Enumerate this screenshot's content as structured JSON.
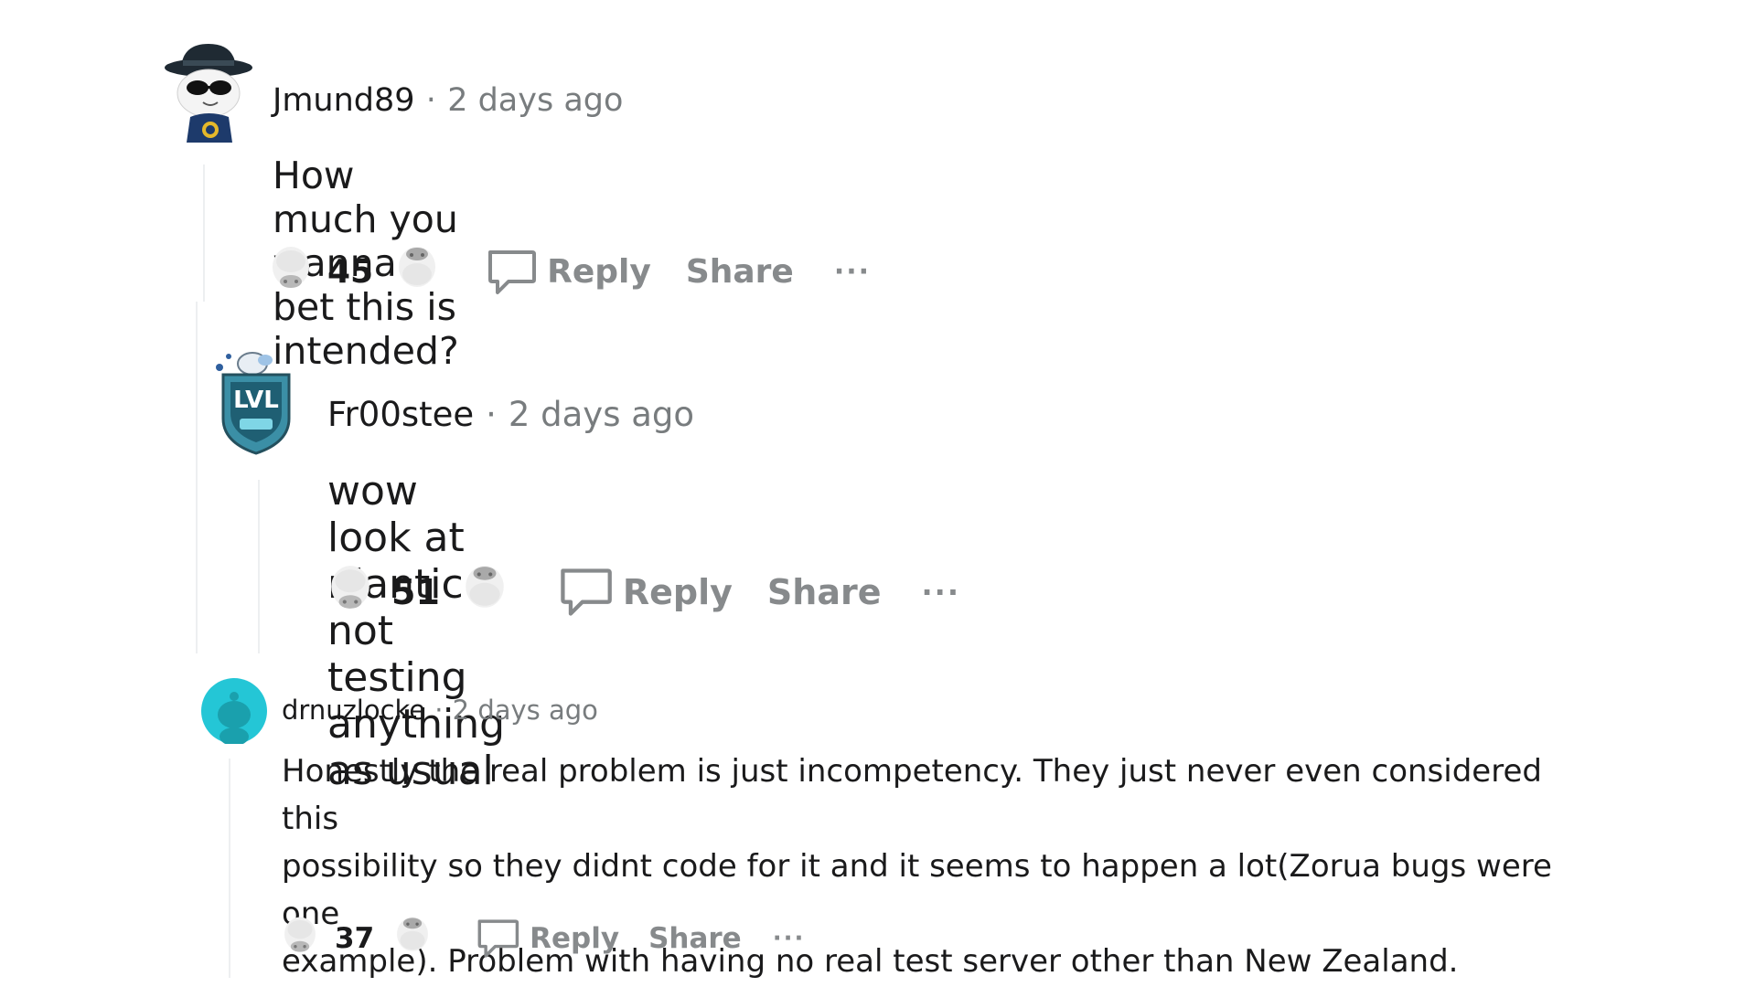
{
  "comments": [
    {
      "username": "Jmund89",
      "separator": "·",
      "timestamp": "2 days ago",
      "body": "How much you wanna bet this is intended?",
      "score": "45",
      "reply_label": "Reply",
      "share_label": "Share",
      "more_label": "···"
    },
    {
      "username": "Fr00stee",
      "separator": "·",
      "timestamp": "2 days ago",
      "body": "wow look at niantic not testing anything as usual",
      "score": "51",
      "reply_label": "Reply",
      "share_label": "Share",
      "more_label": "···"
    },
    {
      "username": "drnuzlocke",
      "separator": "·",
      "timestamp": "2 days ago",
      "body_lines": [
        "Honestly the real problem is just incompetency. They just never even considered this",
        "possibility so they didnt code for it and it seems to happen a lot(Zorua bugs were one",
        "example). Problem with having no real test server other than New Zealand."
      ],
      "score": "37",
      "reply_label": "Reply",
      "share_label": "Share",
      "more_label": "···"
    }
  ],
  "icons": {
    "upvote": "upvote-icon",
    "downvote": "downvote-icon",
    "reply": "comment-bubble-icon",
    "more": "more-options-icon"
  },
  "colors": {
    "text": "#1a1a1b",
    "muted": "#878a8c",
    "timestamp": "#787c7e",
    "thread_line": "#edeff1",
    "avatar_teal": "#24c6d6"
  }
}
